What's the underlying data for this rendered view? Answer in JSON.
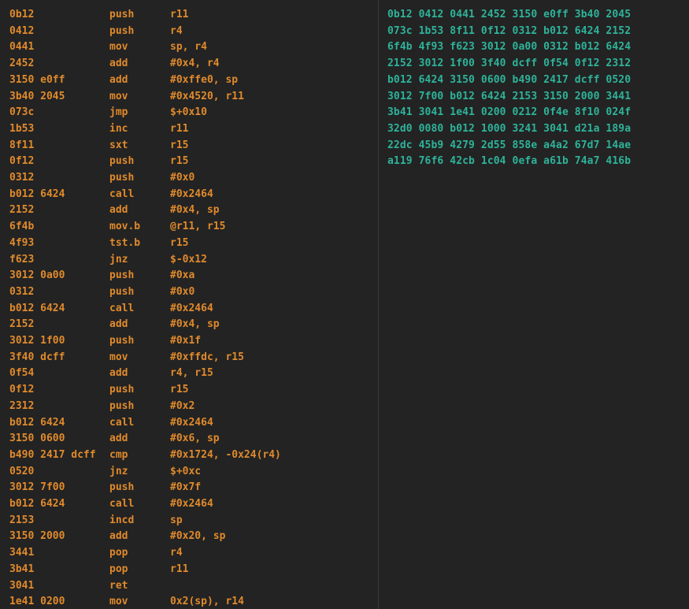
{
  "colors": {
    "background": "#232323",
    "disassembly_text": "#e08a2c",
    "hexdump_text": "#2eb39a",
    "divider": "#3a3a3a"
  },
  "disassembly": [
    {
      "bytes": "0b12",
      "mnemonic": "push",
      "operands": "r11"
    },
    {
      "bytes": "0412",
      "mnemonic": "push",
      "operands": "r4"
    },
    {
      "bytes": "0441",
      "mnemonic": "mov",
      "operands": "sp, r4"
    },
    {
      "bytes": "2452",
      "mnemonic": "add",
      "operands": "#0x4, r4"
    },
    {
      "bytes": "3150 e0ff",
      "mnemonic": "add",
      "operands": "#0xffe0, sp"
    },
    {
      "bytes": "3b40 2045",
      "mnemonic": "mov",
      "operands": "#0x4520, r11"
    },
    {
      "bytes": "073c",
      "mnemonic": "jmp",
      "operands": "$+0x10"
    },
    {
      "bytes": "1b53",
      "mnemonic": "inc",
      "operands": "r11"
    },
    {
      "bytes": "8f11",
      "mnemonic": "sxt",
      "operands": "r15"
    },
    {
      "bytes": "0f12",
      "mnemonic": "push",
      "operands": "r15"
    },
    {
      "bytes": "0312",
      "mnemonic": "push",
      "operands": "#0x0"
    },
    {
      "bytes": "b012 6424",
      "mnemonic": "call",
      "operands": "#0x2464"
    },
    {
      "bytes": "2152",
      "mnemonic": "add",
      "operands": "#0x4, sp"
    },
    {
      "bytes": "6f4b",
      "mnemonic": "mov.b",
      "operands": "@r11, r15"
    },
    {
      "bytes": "4f93",
      "mnemonic": "tst.b",
      "operands": "r15"
    },
    {
      "bytes": "f623",
      "mnemonic": "jnz",
      "operands": "$-0x12"
    },
    {
      "bytes": "3012 0a00",
      "mnemonic": "push",
      "operands": "#0xa"
    },
    {
      "bytes": "0312",
      "mnemonic": "push",
      "operands": "#0x0"
    },
    {
      "bytes": "b012 6424",
      "mnemonic": "call",
      "operands": "#0x2464"
    },
    {
      "bytes": "2152",
      "mnemonic": "add",
      "operands": "#0x4, sp"
    },
    {
      "bytes": "3012 1f00",
      "mnemonic": "push",
      "operands": "#0x1f"
    },
    {
      "bytes": "3f40 dcff",
      "mnemonic": "mov",
      "operands": "#0xffdc, r15"
    },
    {
      "bytes": "0f54",
      "mnemonic": "add",
      "operands": "r4, r15"
    },
    {
      "bytes": "0f12",
      "mnemonic": "push",
      "operands": "r15"
    },
    {
      "bytes": "2312",
      "mnemonic": "push",
      "operands": "#0x2"
    },
    {
      "bytes": "b012 6424",
      "mnemonic": "call",
      "operands": "#0x2464"
    },
    {
      "bytes": "3150 0600",
      "mnemonic": "add",
      "operands": "#0x6, sp"
    },
    {
      "bytes": "b490 2417 dcff",
      "mnemonic": "cmp",
      "operands": "#0x1724, -0x24(r4)"
    },
    {
      "bytes": "0520",
      "mnemonic": "jnz",
      "operands": "$+0xc"
    },
    {
      "bytes": "3012 7f00",
      "mnemonic": "push",
      "operands": "#0x7f"
    },
    {
      "bytes": "b012 6424",
      "mnemonic": "call",
      "operands": "#0x2464"
    },
    {
      "bytes": "2153",
      "mnemonic": "incd",
      "operands": "sp"
    },
    {
      "bytes": "3150 2000",
      "mnemonic": "add",
      "operands": "#0x20, sp"
    },
    {
      "bytes": "3441",
      "mnemonic": "pop",
      "operands": "r4"
    },
    {
      "bytes": "3b41",
      "mnemonic": "pop",
      "operands": "r11"
    },
    {
      "bytes": "3041",
      "mnemonic": "ret",
      "operands": ""
    },
    {
      "bytes": "1e41 0200",
      "mnemonic": "mov",
      "operands": "0x2(sp), r14"
    }
  ],
  "hexdump": [
    "0b12 0412 0441 2452 3150 e0ff 3b40 2045",
    "073c 1b53 8f11 0f12 0312 b012 6424 2152",
    "6f4b 4f93 f623 3012 0a00 0312 b012 6424",
    "2152 3012 1f00 3f40 dcff 0f54 0f12 2312",
    "b012 6424 3150 0600 b490 2417 dcff 0520",
    "3012 7f00 b012 6424 2153 3150 2000 3441",
    "3b41 3041 1e41 0200 0212 0f4e 8f10 024f",
    "32d0 0080 b012 1000 3241 3041 d21a 189a",
    "22dc 45b9 4279 2d55 858e a4a2 67d7 14ae",
    "a119 76f6 42cb 1c04 0efa a61b 74a7 416b"
  ]
}
